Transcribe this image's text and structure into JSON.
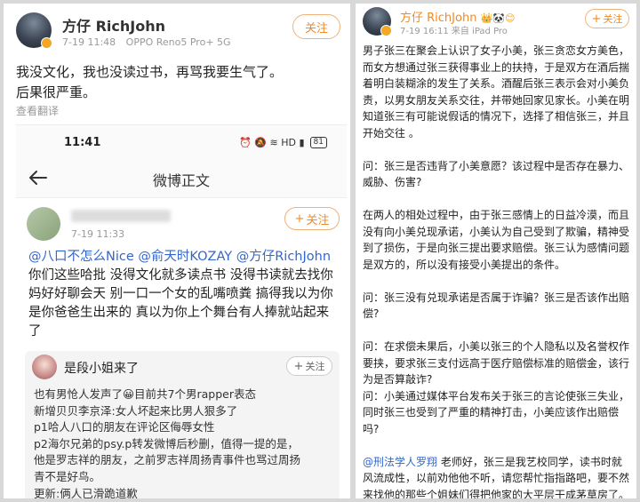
{
  "left_post": {
    "author": "方仔 RichJohn",
    "time": "7-19 11:48",
    "device": "OPPO Reno5 Pro+ 5G",
    "follow_label": "关注",
    "text_line1": "我没文化，我也没读过书，再骂我要生气了。",
    "text_line2": "后果很严重。",
    "translate_label": "查看翻译"
  },
  "embedded": {
    "status_time": "11:41",
    "status_icons": "⏰ 🔕 ≋ HD ▮",
    "battery": "81",
    "nav_title": "微博正文",
    "inner_post": {
      "time": "7-19 11:33",
      "follow_label": "关注",
      "mention1": "@八口不怎么Nice",
      "mention2": "@俞天时KOZAY",
      "mention3": "@方仔RichJohn",
      "text": "你们这些哈批 没得文化就多读点书 没得书读就去找你妈好好聊会天 别一口一个女的乱嘴喷粪 搞得我以为你是你爸爸生出来的 真以为你上个舞台有人捧就站起来了"
    },
    "comment_card": {
      "name": "是段小姐来了",
      "follow_label": "关注",
      "lines": [
        "也有男怆人发声了😀目前共7个男rapper表态",
        "新增贝贝李京泽:女人坏起来比男人狠多了",
        "p1哈人八口的朋友在评论区侮辱女性",
        "p2海尔兄弟的psy.p转发微博后秒删，值得一提的是，",
        "他是罗志祥的朋友，之前罗志祥周扬青事件也骂过周扬",
        "青不是好鸟。",
        "更新:俩人已滑跪道歉"
      ]
    }
  },
  "right_post": {
    "author": "方仔 RichJohn",
    "badges": "👑🐼😊",
    "meta": "7-19 16:11  来自 iPad Pro",
    "follow_label": "关注",
    "paragraphs": [
      "男子张三在聚会上认识了女子小美，张三贪恋女方美色，而女方想通过张三获得事业上的扶持，于是双方在酒后揣着明白装糊涂的发生了关系。酒醒后张三表示会对小美负责，以男女朋友关系交往，并带她回家见家长。小美在明知道张三有可能说假话的情况下，选择了相信张三，并且开始交往 。",
      "问：张三是否违背了小美意愿？该过程中是否存在暴力、威胁、伤害?",
      "在两人的相处过程中，由于张三感情上的日益冷漠，而且没有向小美兑现承诺，小美认为自己受到了欺骗，精神受到了损伤，于是向张三提出要求赔偿。张三认为感情问题是双方的，所以没有接受小美提出的条件。",
      "问：张三没有兑现承诺是否属于诈骗？张三是否该作出赔偿?",
      "问：在求偿未果后，小美以张三的个人隐私以及名誉权作要挟，要求张三支付远高于医疗赔偿标准的赔偿金，该行为是否算敲诈?"
    ],
    "paragraph6": "问：小美通过媒体平台发布关于张三的言论使张三失业，同时张三也受到了严重的精神打击，小美应该作出赔偿吗?",
    "final_mention": "@刑法学人罗翔",
    "final_text": " 老师好，张三是我艺校同学，读书时就风流成性，以前劝他他不听，请您帮忙指指路吧，要不然来找他的那些个姐妹们得把他家的大平层干成茅草房了。"
  },
  "colors": {
    "accent_orange": "#f08a24",
    "mention_blue": "#3366cc"
  }
}
